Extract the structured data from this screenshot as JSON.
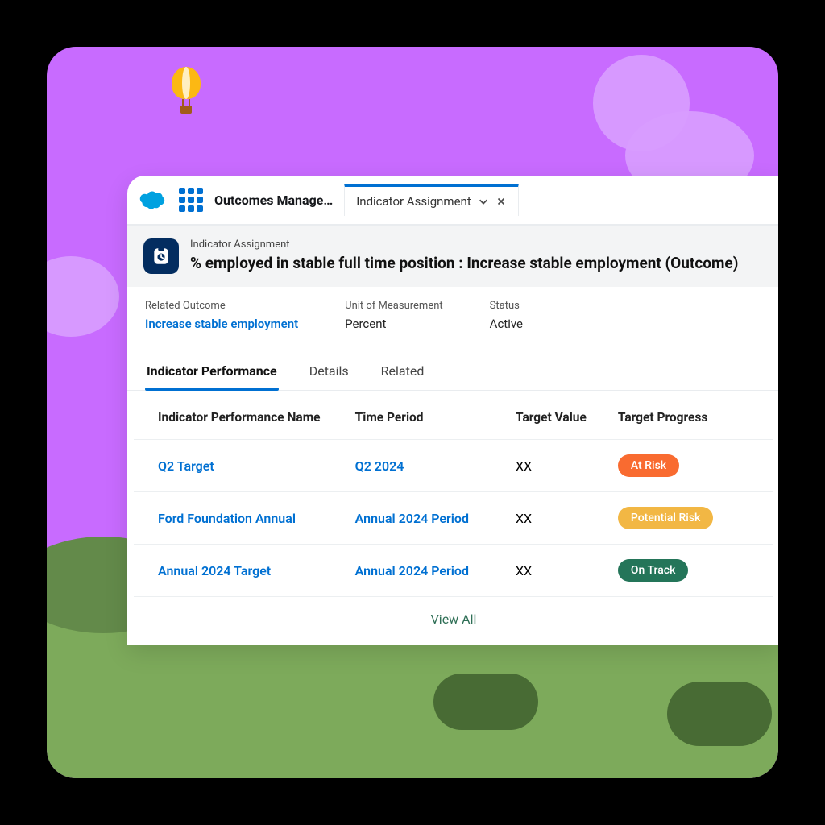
{
  "colors": {
    "accent": "#0070d2",
    "pill_at_risk": "#f96b30",
    "pill_potential_risk": "#f2b744",
    "pill_on_track": "#247559"
  },
  "header": {
    "app_name": "Outcomes Manage…",
    "tab_label": "Indicator Assignment"
  },
  "record": {
    "object_label": "Indicator Assignment",
    "title": "% employed in stable full time position : Increase stable employment (Outcome)"
  },
  "highlights": {
    "related_outcome": {
      "label": "Related Outcome",
      "value": "Increase stable employment"
    },
    "unit": {
      "label": "Unit of Measurement",
      "value": "Percent"
    },
    "status": {
      "label": "Status",
      "value": "Active"
    }
  },
  "tabs": {
    "performance": "Indicator Performance",
    "details": "Details",
    "related": "Related"
  },
  "table": {
    "headers": {
      "name": "Indicator Performance Name",
      "period": "Time Period",
      "target": "Target Value",
      "progress": "Target Progress"
    },
    "rows": [
      {
        "name": "Q2 Target",
        "period": "Q2 2024",
        "target": "XX",
        "progress": "At Risk",
        "progress_class": "atrisk"
      },
      {
        "name": "Ford Foundation Annual",
        "period": "Annual 2024 Period",
        "target": "XX",
        "progress": "Potential Risk",
        "progress_class": "potrisk"
      },
      {
        "name": "Annual 2024 Target",
        "period": "Annual 2024 Period",
        "target": "XX",
        "progress": "On Track",
        "progress_class": "ontrack"
      }
    ],
    "view_all": "View All"
  }
}
